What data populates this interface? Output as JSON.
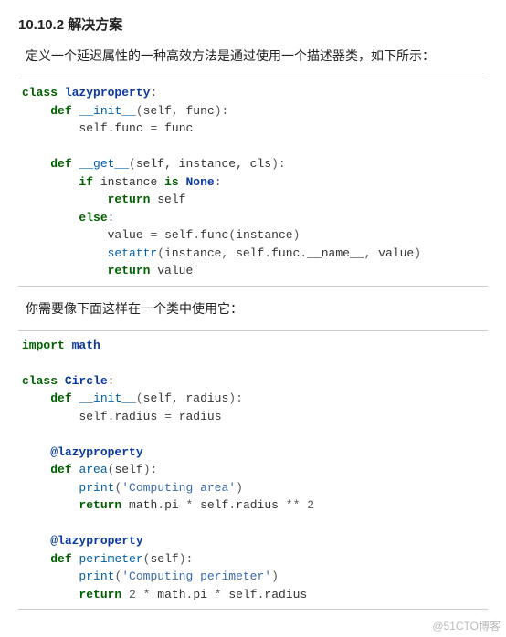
{
  "heading": "10.10.2  解决方案",
  "para1": "定义一个延迟属性的一种高效方法是通过使用一个描述器类，如下所示：",
  "code1": {
    "t": [
      {
        "k": "class",
        "sp": " ",
        "cls": "lazyproperty",
        "colon": ":"
      },
      {
        "indent": "    ",
        "k": "def",
        "sp": " ",
        "fn": "__init__",
        "paren_l": "(",
        "args": "self, func",
        "paren_r": ")",
        "colon": ":"
      },
      {
        "indent": "        ",
        "lhs": "self",
        "op1": ".",
        "attr": "func",
        "sp": " ",
        "eq": "=",
        "sp2": " ",
        "rhs": "func"
      },
      "",
      {
        "indent": "    ",
        "k": "def",
        "sp": " ",
        "fn": "__get__",
        "paren_l": "(",
        "args": "self, instance, cls",
        "paren_r": ")",
        "colon": ":"
      },
      {
        "indent": "        ",
        "k": "if",
        "sp": " ",
        "id": "instance",
        "sp2": " ",
        "k2": "is",
        "sp3": " ",
        "cls": "None",
        "colon": ":"
      },
      {
        "indent": "            ",
        "k": "return",
        "sp": " ",
        "id": "self"
      },
      {
        "indent": "        ",
        "k": "else",
        "colon": ":"
      },
      {
        "indent": "            ",
        "lhs": "value",
        "sp": " ",
        "eq": "=",
        "sp2": " ",
        "rhs1": "self",
        "op1": ".",
        "rhs2": "func",
        "paren_l": "(",
        "args": "instance",
        "paren_r": ")"
      },
      {
        "indent": "            ",
        "fn": "setattr",
        "paren_l": "(",
        "a1": "instance",
        "c1": ", ",
        "a2": "self",
        "op1": ".",
        "a3": "func",
        "op2": ".",
        "a4": "__name__",
        "c2": ", ",
        "a5": "value",
        "paren_r": ")"
      },
      {
        "indent": "            ",
        "k": "return",
        "sp": " ",
        "id": "value"
      }
    ]
  },
  "para2": "你需要像下面这样在一个类中使用它：",
  "code2": {
    "t": [
      {
        "k": "import",
        "sp": " ",
        "cls": "math"
      },
      "",
      {
        "k": "class",
        "sp": " ",
        "cls": "Circle",
        "colon": ":"
      },
      {
        "indent": "    ",
        "k": "def",
        "sp": " ",
        "fn": "__init__",
        "paren_l": "(",
        "args": "self, radius",
        "paren_r": ")",
        "colon": ":"
      },
      {
        "indent": "        ",
        "lhs": "self",
        "op1": ".",
        "attr": "radius",
        "sp": " ",
        "eq": "=",
        "sp2": " ",
        "rhs": "radius"
      },
      "",
      {
        "indent": "    ",
        "dec": "@lazyproperty"
      },
      {
        "indent": "    ",
        "k": "def",
        "sp": " ",
        "fn": "area",
        "paren_l": "(",
        "args": "self",
        "paren_r": ")",
        "colon": ":"
      },
      {
        "indent": "        ",
        "fn": "print",
        "paren_l": "(",
        "str": "'Computing area'",
        "paren_r": ")"
      },
      {
        "indent": "        ",
        "k": "return",
        "sp": " ",
        "a1": "math",
        "op1": ".",
        "a2": "pi",
        "sp2": " ",
        "op2": "*",
        "sp3": " ",
        "a3": "self",
        "op3": ".",
        "a4": "radius",
        "sp4": " ",
        "op4": "**",
        "sp5": " ",
        "num": "2"
      },
      "",
      {
        "indent": "    ",
        "dec": "@lazyproperty"
      },
      {
        "indent": "    ",
        "k": "def",
        "sp": " ",
        "fn": "perimeter",
        "paren_l": "(",
        "args": "self",
        "paren_r": ")",
        "colon": ":"
      },
      {
        "indent": "        ",
        "fn": "print",
        "paren_l": "(",
        "str": "'Computing perimeter'",
        "paren_r": ")"
      },
      {
        "indent": "        ",
        "k": "return",
        "sp": " ",
        "num": "2",
        "sp2": " ",
        "op1": "*",
        "sp3": " ",
        "a1": "math",
        "op2": ".",
        "a2": "pi",
        "sp4": " ",
        "op3": "*",
        "sp5": " ",
        "a3": "self",
        "op4": ".",
        "a4": "radius"
      }
    ]
  },
  "watermark": "@51CTO博客"
}
